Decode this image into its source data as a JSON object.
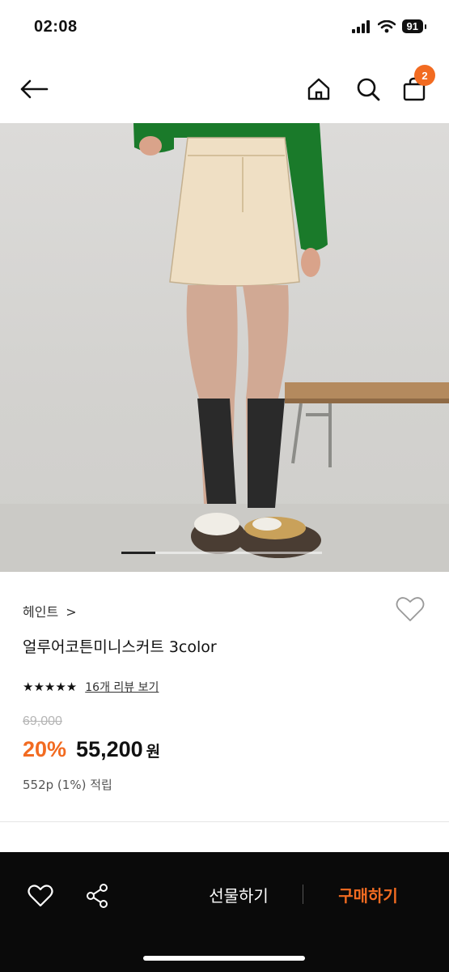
{
  "status": {
    "time": "02:08",
    "battery": "91"
  },
  "nav": {
    "cart_count": "2"
  },
  "product": {
    "brand": "헤인트",
    "brand_chevron": ">",
    "name": "얼루어코튼미니스커트 3color",
    "stars": "★★★★★",
    "rating_fraction": 1.0,
    "review_link": "16개 리뷰 보기",
    "original_price": "69,000",
    "discount": "20%",
    "sale_price": "55,200",
    "currency": "원",
    "points": "552p (1%) 적립"
  },
  "carousel": {
    "current": 1,
    "total": 6
  },
  "bottom_bar": {
    "gift_label": "선물하기",
    "buy_label": "구매하기"
  },
  "icons": [
    "back-arrow-icon",
    "home-icon",
    "search-icon",
    "cart-icon",
    "heart-icon",
    "share-icon"
  ],
  "colors": {
    "accent": "#f26b21",
    "bottom_bar_bg": "#0a0a0a"
  }
}
